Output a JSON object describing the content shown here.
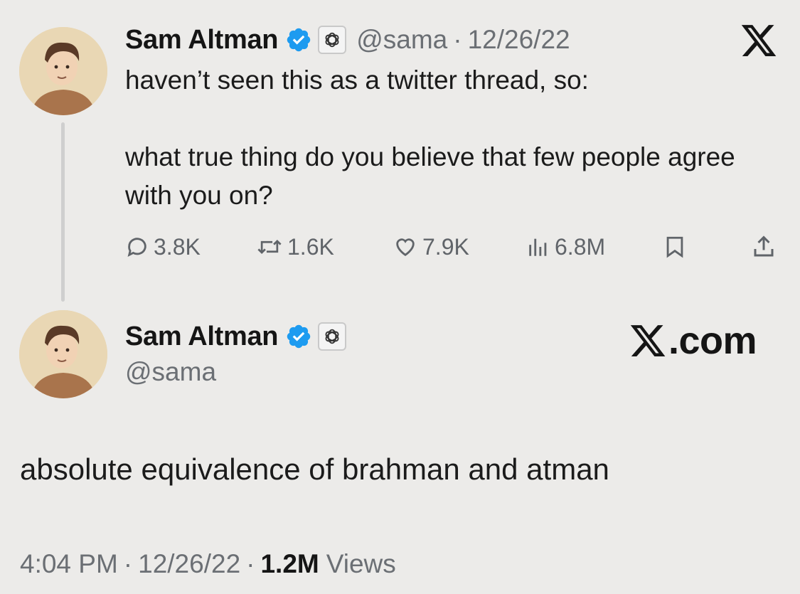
{
  "original_tweet": {
    "display_name": "Sam Altman",
    "handle": "@sama",
    "separator": "·",
    "date": "12/26/22",
    "text_line_1": "haven’t seen this as a twitter thread, so:",
    "text_line_2": "what true thing do you believe that few people agree with you on?",
    "stats": {
      "replies": "3.8K",
      "retweets": "1.6K",
      "likes": "7.9K",
      "views": "6.8M"
    },
    "icons": {
      "verified": "verified-badge-icon",
      "affiliate": "openai-logo-icon",
      "platform": "x-logo-icon",
      "reply": "comment-icon",
      "retweet": "retweet-icon",
      "like": "heart-icon",
      "views": "bar-chart-icon",
      "bookmark": "bookmark-icon",
      "share": "share-icon"
    }
  },
  "reply_tweet": {
    "display_name": "Sam Altman",
    "handle": "@sama",
    "brand": ".com",
    "text": "absolute equivalence of brahman and atman",
    "time": "4:04 PM",
    "separator": "·",
    "date": "12/26/22",
    "views_count": "1.2M",
    "views_label": "Views"
  },
  "colors": {
    "background": "#ecebe9",
    "verified_blue": "#1d9bf0",
    "text_primary": "#1b1b1b",
    "text_secondary": "#6b6f74",
    "thread_line": "#cfcfcf"
  }
}
